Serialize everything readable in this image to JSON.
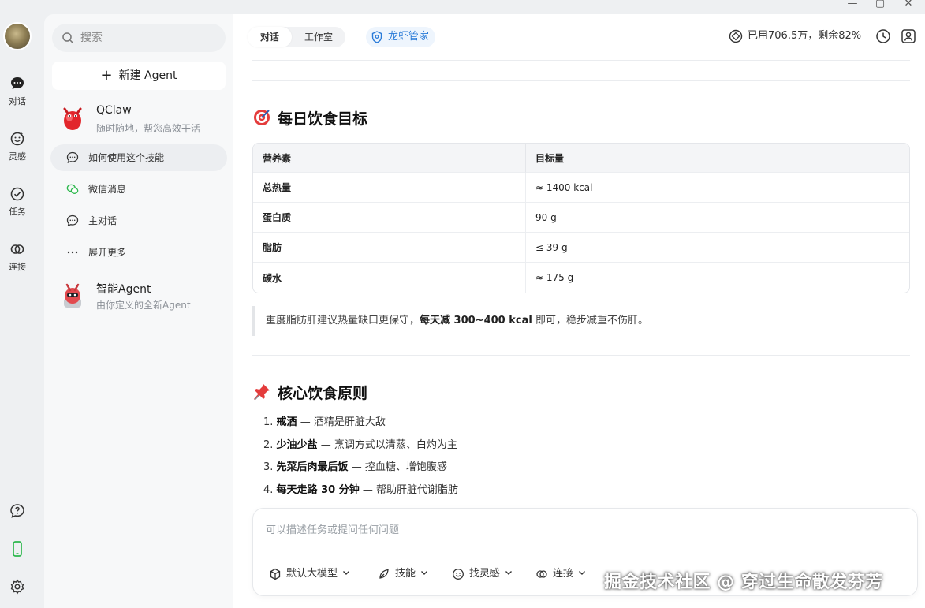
{
  "window": {
    "minimize": "—",
    "maximize": "▢",
    "close": "✕"
  },
  "rail": {
    "items": [
      {
        "label": "对话",
        "icon": "chat-icon"
      },
      {
        "label": "灵感",
        "icon": "inspiration-icon"
      },
      {
        "label": "任务",
        "icon": "task-icon"
      },
      {
        "label": "连接",
        "icon": "link-icon"
      }
    ],
    "bottom_icons": [
      "help-icon",
      "phone-icon",
      "settings-icon"
    ],
    "accent": "#2db84d"
  },
  "sidebar": {
    "search_placeholder": "搜索",
    "new_agent_label": "新建 Agent",
    "agents": [
      {
        "name": "QClaw",
        "desc": "随时随地，帮您高效干活"
      },
      {
        "name": "智能Agent",
        "desc": "由你定义的全新Agent"
      }
    ],
    "items": [
      {
        "label": "如何使用这个技能",
        "icon": "chat-icon"
      },
      {
        "label": "微信消息",
        "icon": "wechat-icon"
      },
      {
        "label": "主对话",
        "icon": "chat-icon"
      },
      {
        "label": "展开更多",
        "icon": "more-icon"
      }
    ]
  },
  "topbar": {
    "tabs": [
      "对话",
      "工作室"
    ],
    "active_tab": "对话",
    "lobster_label": "龙虾管家",
    "quota": "已用706.5万，剩余82%",
    "accent": "#2a7bd8"
  },
  "content": {
    "section1_title": "每日饮食目标",
    "table_headers": [
      "营养素",
      "目标量"
    ],
    "table_rows": [
      [
        "总热量",
        "≈ 1400 kcal"
      ],
      [
        "蛋白质",
        "90 g"
      ],
      [
        "脂肪",
        "≤ 39 g"
      ],
      [
        "碳水",
        "≈ 175 g"
      ]
    ],
    "note_pre": "重度脂肪肝建议热量缺口更保守，",
    "note_bold": "每天减 300~400 kcal",
    "note_post": " 即可，稳步减重不伤肝。",
    "section2_title": "核心饮食原则",
    "principles": [
      {
        "num": "1.",
        "bold": "戒酒",
        "text": " — 酒精是肝脏大敌"
      },
      {
        "num": "2.",
        "bold": "少油少盐",
        "text": " — 烹调方式以清蒸、白灼为主"
      },
      {
        "num": "3.",
        "bold": "先菜后肉最后饭",
        "text": " — 控血糖、增饱腹感"
      },
      {
        "num": "4.",
        "bold": "每天走路 30 分钟",
        "text": " — 帮助肝脏代谢脂肪"
      }
    ]
  },
  "composer": {
    "placeholder": "可以描述任务或提问任何问题",
    "buttons": [
      "默认大模型",
      "技能",
      "找灵感",
      "连接"
    ]
  },
  "watermark": "掘金技术社区 @ 穿过生命散发芬芳"
}
